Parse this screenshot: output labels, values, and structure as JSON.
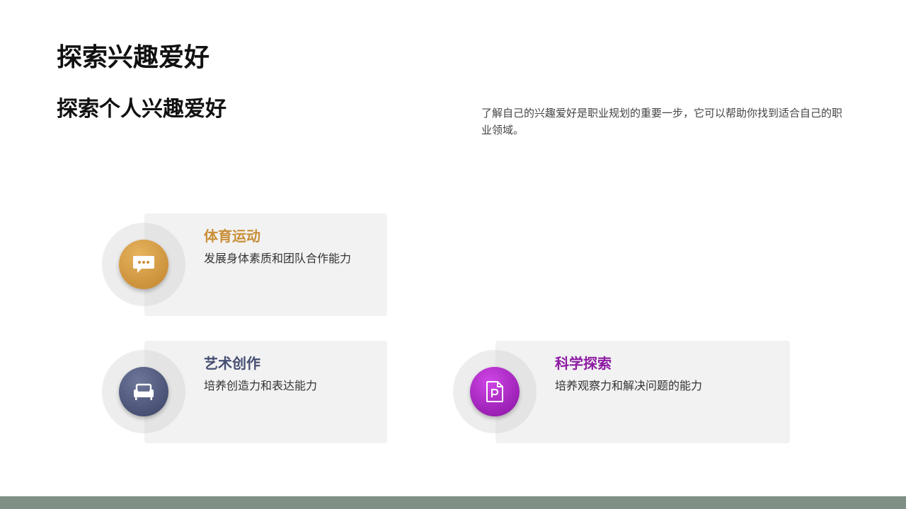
{
  "slide": {
    "title": "探索兴趣爱好",
    "subtitle": "探索个人兴趣爱好",
    "intro": "了解自己的兴趣爱好是职业规划的重要一步，它可以帮助你找到适合自己的职业领域。"
  },
  "cards": [
    {
      "title": "体育运动",
      "description": "发展身体素质和团队合作能力",
      "icon": "chat-bubble-icon",
      "accent_color": "#c98f38",
      "gradient": [
        "#e2ac55",
        "#c1842e"
      ]
    },
    {
      "title": "艺术创作",
      "description": "培养创造力和表达能力",
      "icon": "armchair-icon",
      "accent_color": "#454e72",
      "gradient": [
        "#6a7396",
        "#3a4266"
      ]
    },
    {
      "title": "科学探索",
      "description": "培养观察力和解决问题的能力",
      "icon": "document-p-icon",
      "accent_color": "#8e1aa3",
      "gradient": [
        "#c83be0",
        "#8612a0"
      ]
    }
  ],
  "colors": {
    "background": "#ffffff",
    "card_background": "#f2f2f2",
    "bottom_bar": "#7f8f86"
  }
}
